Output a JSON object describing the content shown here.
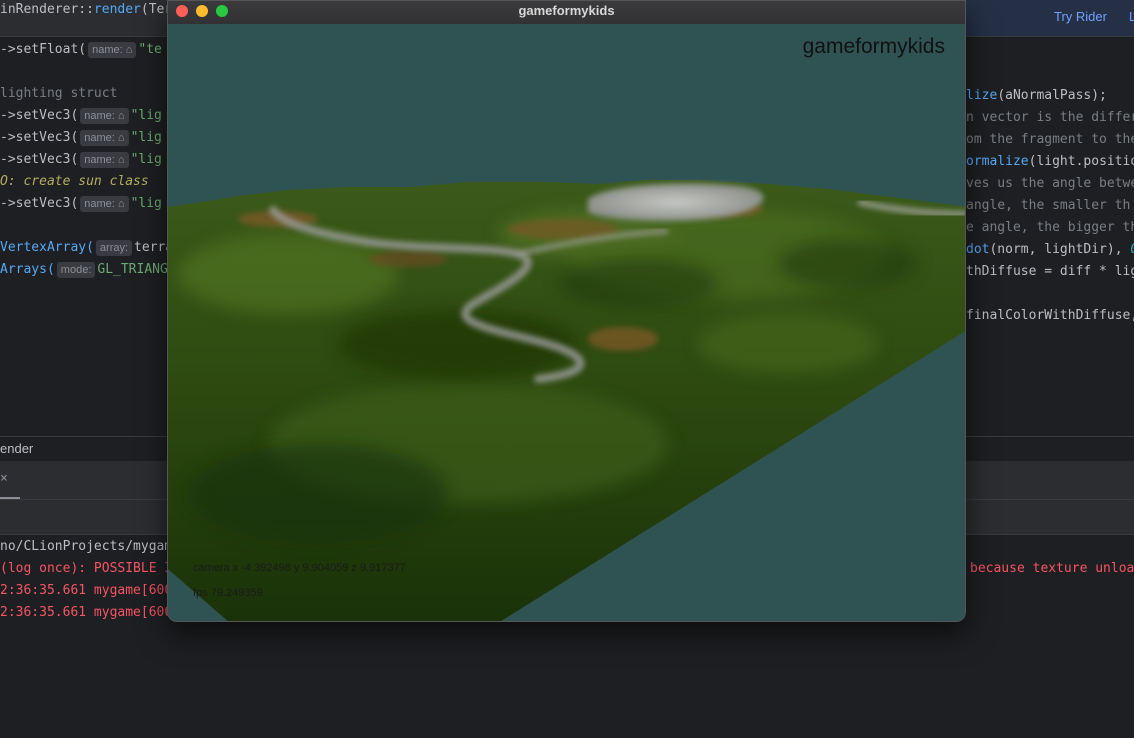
{
  "ide": {
    "breadcrumb_prefix": "inRenderer::",
    "breadcrumb_fn": "render",
    "breadcrumb_suffix": "(Ter",
    "try_rider": "Try Rider",
    "try_rider_extra": "L",
    "left_code": [
      {
        "pre": "->setFloat(",
        "hint": "name: ",
        "str": "\"te"
      },
      {
        "comment": " lighting struct"
      },
      {
        "pre": "->setVec3(",
        "hint": "name: ",
        "str": "\"lig"
      },
      {
        "pre": "->setVec3(",
        "hint": "name: ",
        "str": "\"lig"
      },
      {
        "pre": "->setVec3(",
        "hint": "name: ",
        "str": "\"lig"
      },
      {
        "todo": "O: create sun class"
      },
      {
        "pre": "->setVec3(",
        "hint": "name: ",
        "str": "\"lig"
      },
      {
        "pre2": "VertexArray(",
        "hint": "array: ",
        "tail": "terra"
      },
      {
        "pre2": "Arrays(",
        "hint": "mode: ",
        "tail": "GL_TRIANG"
      }
    ],
    "right_code": [
      {
        "fn": "lize",
        "rest": "(aNormalPass);"
      },
      {
        "comment": "n vector is the differ"
      },
      {
        "comment": "om the fragment to the"
      },
      {
        "fn": "ormalize",
        "rest": "(light.positio"
      },
      {
        "comment": "ves us the angle betwe"
      },
      {
        "comment": " angle, the smaller th"
      },
      {
        "comment": "e angle, the bigger th"
      },
      {
        "fn": "dot",
        "rest": "(norm, lightDir), ",
        "num": "0"
      },
      {
        "plain": "thDiffuse = diff * lig"
      },
      {
        "plain": "finalColorWithDiffuse,"
      }
    ],
    "run_label": "ender",
    "run_close": "×",
    "console": {
      "path": "no/CLionProjects/mygam",
      "lines": [
        "(log once): POSSIBLE I",
        "2:36:35.661 mygame[600",
        "2:36:35.661 mygame[600"
      ],
      "right_err": "because texture unloa"
    }
  },
  "game_window": {
    "title": "gameformykids",
    "hud_title": "gameformykids",
    "camera": "camera x -4.392498 y 9.904059 z 9.917377",
    "fps": "fps 79.249359",
    "colors": {
      "sky": "#2f5352",
      "grass_dark": "#1d3a0c",
      "grass_light": "#4c6b1e",
      "dirt": "#8a5a2a",
      "road": "#9a9a98",
      "snow": "#b7bbb8"
    }
  }
}
